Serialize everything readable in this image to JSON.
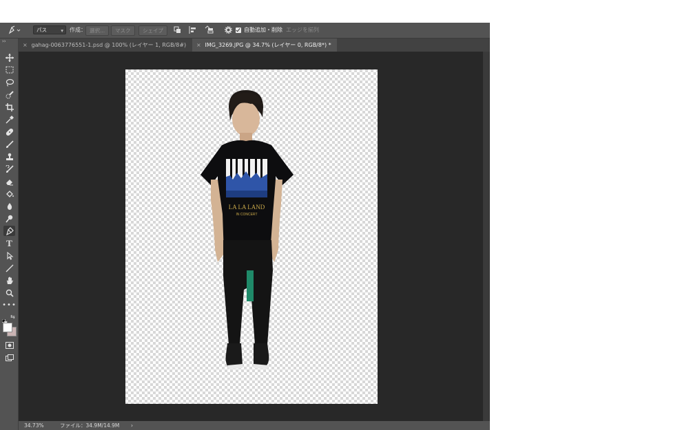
{
  "options_bar": {
    "tool_icon": "pen-tool-icon",
    "mode_select": "パス",
    "make_label": "作成：",
    "selection_button": "選択...",
    "mask_button": "マスク",
    "shape_button": "シェイプ",
    "auto_add_delete_label": "自動追加・削除",
    "auto_add_delete_checked": true,
    "align_edges_label": "エッジを揃列"
  },
  "tabs": [
    {
      "title": "gahag-0063776551-1.psd @ 100% (レイヤー 1, RGB/8#)",
      "active": false
    },
    {
      "title": "IMG_3269.JPG @ 34.7% (レイヤー 0, RGB/8*) *",
      "active": true
    }
  ],
  "tools": [
    "move-tool",
    "marquee-tool",
    "lasso-tool",
    "quick-select-tool",
    "crop-tool",
    "eyedropper-tool",
    "healing-brush-tool",
    "brush-tool",
    "clone-stamp-tool",
    "history-brush-tool",
    "eraser-tool",
    "paint-bucket-tool",
    "blur-tool",
    "dodge-tool",
    "pen-tool",
    "type-tool",
    "path-selection-tool",
    "line-tool",
    "hand-tool",
    "zoom-tool",
    "more-tools"
  ],
  "active_tool": "pen-tool",
  "canvas": {
    "shirt_text": "LA LA LAND",
    "shirt_subtext": "IN CONCERT"
  },
  "status": {
    "zoom": "34.73%",
    "file_info": "ファイル：34.9M/14.9M",
    "arrow": "›"
  },
  "colors": {
    "foreground": "#ffffff",
    "background": "#c9b3b3",
    "shirt_blue": "#2f55a8",
    "shirt_gold": "#c8a84a"
  }
}
